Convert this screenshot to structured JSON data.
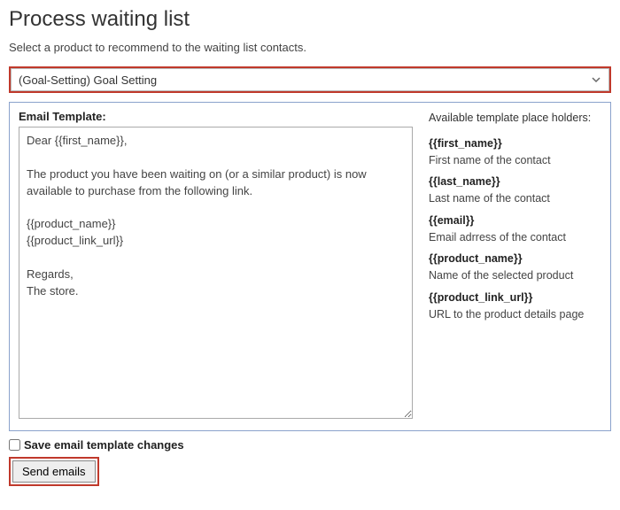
{
  "page": {
    "title": "Process waiting list",
    "instruction": "Select a product to recommend to the waiting list contacts."
  },
  "product_select": {
    "selected": "(Goal-Setting) Goal Setting"
  },
  "template": {
    "label": "Email Template:",
    "body": "Dear {{first_name}},\n\nThe product you have been waiting on (or a similar product) is now available to purchase from the following link.\n\n{{product_name}}\n{{product_link_url}}\n\nRegards,\nThe store."
  },
  "placeholders": {
    "title": "Available template place holders:",
    "items": [
      {
        "token": "{{first_name}}",
        "desc": "First name of the contact"
      },
      {
        "token": "{{last_name}}",
        "desc": "Last name of the contact"
      },
      {
        "token": "{{email}}",
        "desc": "Email adrress of the contact"
      },
      {
        "token": "{{product_name}}",
        "desc": "Name of the selected product"
      },
      {
        "token": "{{product_link_url}}",
        "desc": "URL to the product details page"
      }
    ]
  },
  "footer": {
    "save_checkbox_label": "Save email template changes",
    "send_button_label": "Send emails"
  }
}
